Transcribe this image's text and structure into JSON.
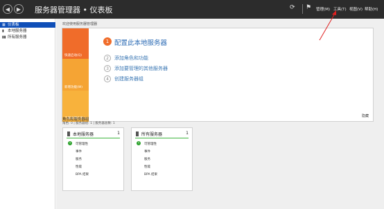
{
  "header": {
    "title": "服务器管理器 • 仪表板",
    "menu": [
      {
        "label": "管理(M)"
      },
      {
        "label": "工具(T)"
      },
      {
        "label": "视图(V)"
      },
      {
        "label": "帮助(H)"
      }
    ],
    "back_icon": "back-arrow-icon",
    "forward_icon": "forward-arrow-icon",
    "refresh_icon": "refresh-icon",
    "flag_icon": "notification-flag-icon"
  },
  "sidebar": {
    "items": [
      {
        "label": "仪表板",
        "icon": "dashboard-icon",
        "active": true
      },
      {
        "label": "本地服务器",
        "icon": "server-icon",
        "active": false
      },
      {
        "label": "所有服务器",
        "icon": "servers-icon",
        "active": false
      }
    ]
  },
  "welcome": {
    "title": "欢迎使用服务器管理器",
    "tiles": [
      {
        "label": "快速启动(Q)"
      },
      {
        "label": "新增功能(W)"
      },
      {
        "label": "了解详细信息(L)"
      }
    ],
    "steps": [
      {
        "num": "1",
        "label": "配置此本地服务器"
      },
      {
        "num": "2",
        "label": "添加角色和功能"
      },
      {
        "num": "3",
        "label": "添加要管理的其他服务器"
      },
      {
        "num": "4",
        "label": "创建服务器组"
      }
    ],
    "hide": "隐藏"
  },
  "roles": {
    "title": "角色和服务器组",
    "subtitle": "角色: 0 | 服务器组: 1 | 服务器总数: 1",
    "cards": [
      {
        "title": "本地服务器",
        "count": "1",
        "rows": [
          "可管理性",
          "事件",
          "服务",
          "性能",
          "BPA 结果"
        ]
      },
      {
        "title": "所有服务器",
        "count": "1",
        "rows": [
          "可管理性",
          "事件",
          "服务",
          "性能",
          "BPA 结果"
        ]
      }
    ]
  },
  "colors": {
    "header": "#2c2c2c",
    "active": "#0f4fb8",
    "orange": "#f06c2a",
    "ok": "#3cb43c",
    "annotation": "#e02020"
  }
}
